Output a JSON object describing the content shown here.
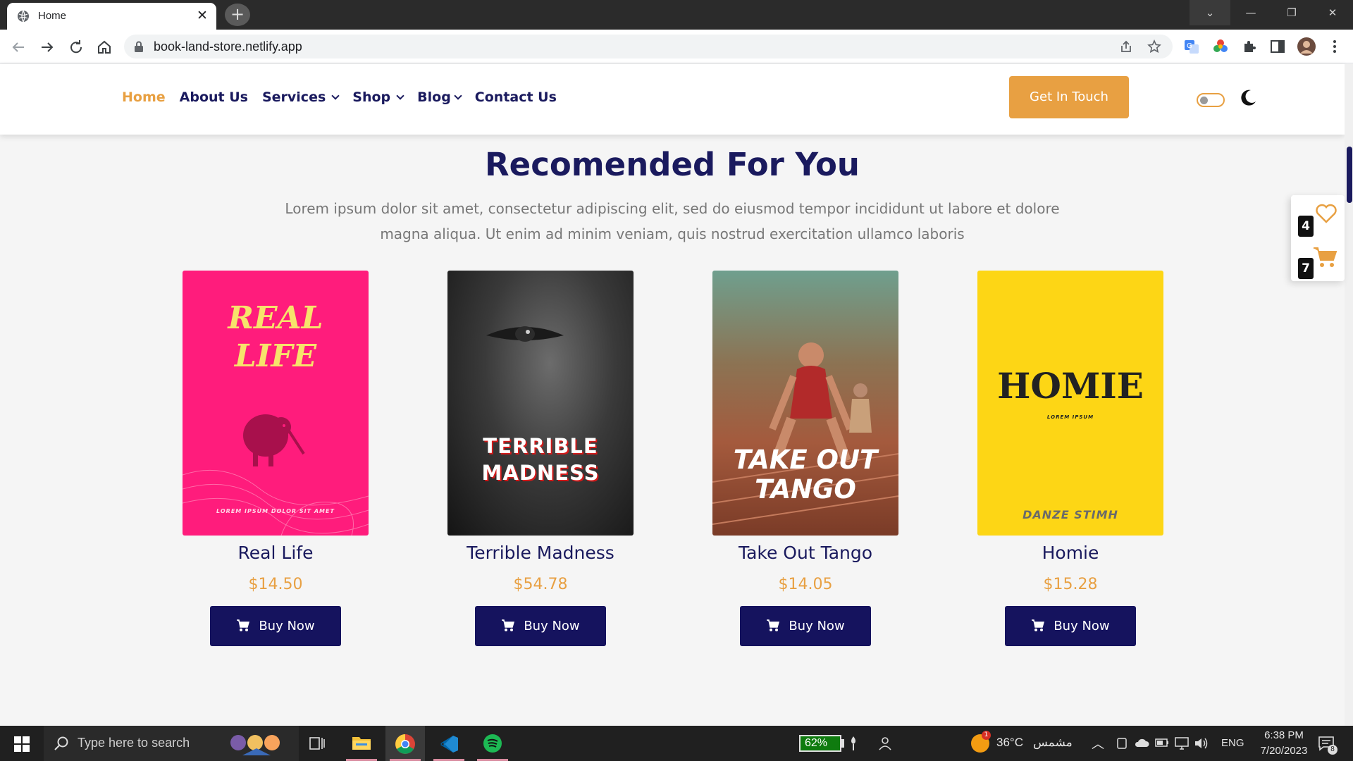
{
  "browser": {
    "tab_title": "Home",
    "tab_close": "✕",
    "new_tab": "+",
    "url": "book-land-store.netlify.app",
    "window_controls": {
      "tabs_menu": "⌄",
      "minimize": "—",
      "restore": "❐",
      "close": "✕"
    }
  },
  "nav": {
    "items": [
      {
        "label": "Home",
        "active": true,
        "dropdown": false
      },
      {
        "label": "About Us",
        "active": false,
        "dropdown": false
      },
      {
        "label": "Services",
        "active": false,
        "dropdown": true
      },
      {
        "label": "Shop",
        "active": false,
        "dropdown": true
      },
      {
        "label": "Blog",
        "active": false,
        "dropdown": true
      },
      {
        "label": "Contact Us",
        "active": false,
        "dropdown": false
      }
    ],
    "cta_label": "Get In Touch"
  },
  "section": {
    "title": "Recomended For You",
    "description": "Lorem ipsum dolor sit amet, consectetur adipiscing elit, sed do eiusmod tempor incididunt ut labore et dolore magna aliqua. Ut enim ad minim veniam, quis nostrud exercitation ullamco laboris"
  },
  "books": [
    {
      "name": "Real Life",
      "price": "$14.50",
      "buy_label": "Buy Now",
      "cover": {
        "title_line1": "REAL",
        "title_line2": "LIFE",
        "subtitle": "LOREM IPSUM DOLOR SIT AMET"
      }
    },
    {
      "name": "Terrible Madness",
      "price": "$54.78",
      "buy_label": "Buy Now",
      "cover": {
        "title_line1": "TERRIBLE",
        "title_line2": "MADNESS"
      }
    },
    {
      "name": "Take Out Tango",
      "price": "$14.05",
      "buy_label": "Buy Now",
      "cover": {
        "title_line1": "TAKE OUT",
        "title_line2": "TANGO"
      }
    },
    {
      "name": "Homie",
      "price": "$15.28",
      "buy_label": "Buy Now",
      "cover": {
        "title": "HOMIE",
        "subtitle": "LOREM IPSUM",
        "author": "DANZE STIMH"
      }
    }
  ],
  "floating": {
    "wishlist_count": "4",
    "cart_count": "7"
  },
  "taskbar": {
    "search_placeholder": "Type here to search",
    "battery": "62%",
    "weather_temp": "36°C",
    "weather_label": "مشمس",
    "weather_badge": "1",
    "language": "ENG",
    "time": "6:38 PM",
    "date": "7/20/2023",
    "notifications": "8"
  },
  "colors": {
    "accent": "#e8a042",
    "navy": "#1a1a5e",
    "button": "#15135e",
    "page_bg": "#f5f5f5"
  }
}
